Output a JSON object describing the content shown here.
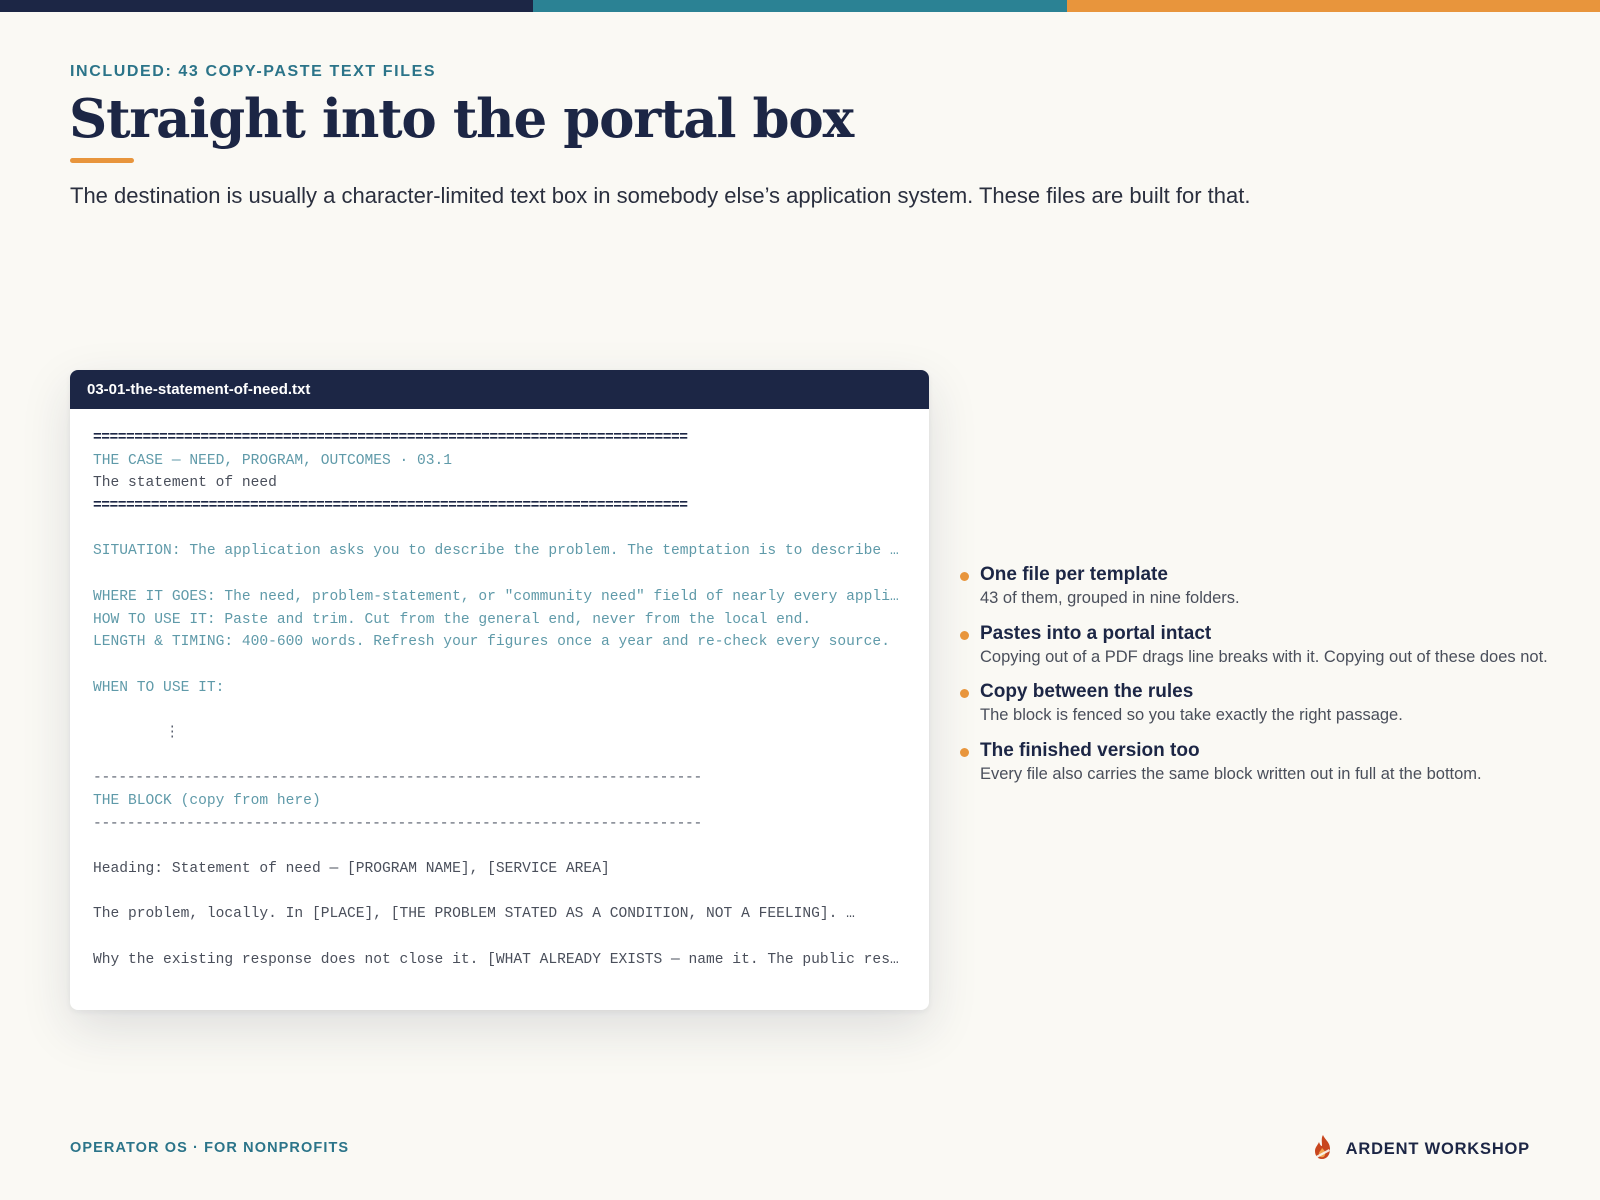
{
  "colors": {
    "navy": "#1c2645",
    "teal": "#2b7489",
    "orange": "#e8953c",
    "background": "#faf9f4"
  },
  "topbar": {
    "segments": [
      "#1c2645",
      "#2b8294",
      "#e8953c"
    ]
  },
  "header": {
    "eyebrow": "INCLUDED: 43 COPY-PASTE TEXT FILES",
    "title": "Straight into the portal box",
    "lede": "The destination is usually a character-limited text box in somebody else’s application system. These files are built for that."
  },
  "file": {
    "name": "03-01-the-statement-of-need.txt",
    "rule_line": "========================================================================",
    "dash_line": "------------------------------------------------------------------------",
    "section_line": "THE CASE — NEED, PROGRAM, OUTCOMES  ·  03.1",
    "doc_title": "The statement of need",
    "situation": "SITUATION: The application asks you to describe the problem. The temptation is to describe the problem everywhere.",
    "where": "WHERE IT GOES:   The need, problem-statement, or \"community need\" field of nearly every application.",
    "how": "HOW TO USE IT:   Paste and trim. Cut from the general end, never from the local end.",
    "length": "LENGTH & TIMING: 400-600 words. Refresh your figures once a year and re-check every source.",
    "when": "WHEN TO USE IT:",
    "ellipsis": "⋮",
    "block_label": "THE BLOCK (copy from here)",
    "heading": "Heading: Statement of need — [PROGRAM NAME], [SERVICE AREA]",
    "problem": "The problem, locally. In [PLACE], [THE PROBLEM STATED AS A CONDITION, NOT A FEELING]. …",
    "why": "Why the existing response does not close it. [WHAT ALREADY EXISTS — name it. The public response covers part of the need.]"
  },
  "features": [
    {
      "title": "One file per template",
      "desc": "43 of them, grouped in nine folders."
    },
    {
      "title": "Pastes into a portal intact",
      "desc": "Copying out of a PDF drags line breaks with it. Copying out of these does not."
    },
    {
      "title": "Copy between the rules",
      "desc": "The block is fenced so you take exactly the right passage."
    },
    {
      "title": "The finished version too",
      "desc": "Every file also carries the same block written out in full at the bottom."
    }
  ],
  "footer": {
    "left": "OPERATOR OS · FOR NONPROFITS",
    "brand": "ARDENT WORKSHOP",
    "brand_icon": "flame-icon"
  }
}
